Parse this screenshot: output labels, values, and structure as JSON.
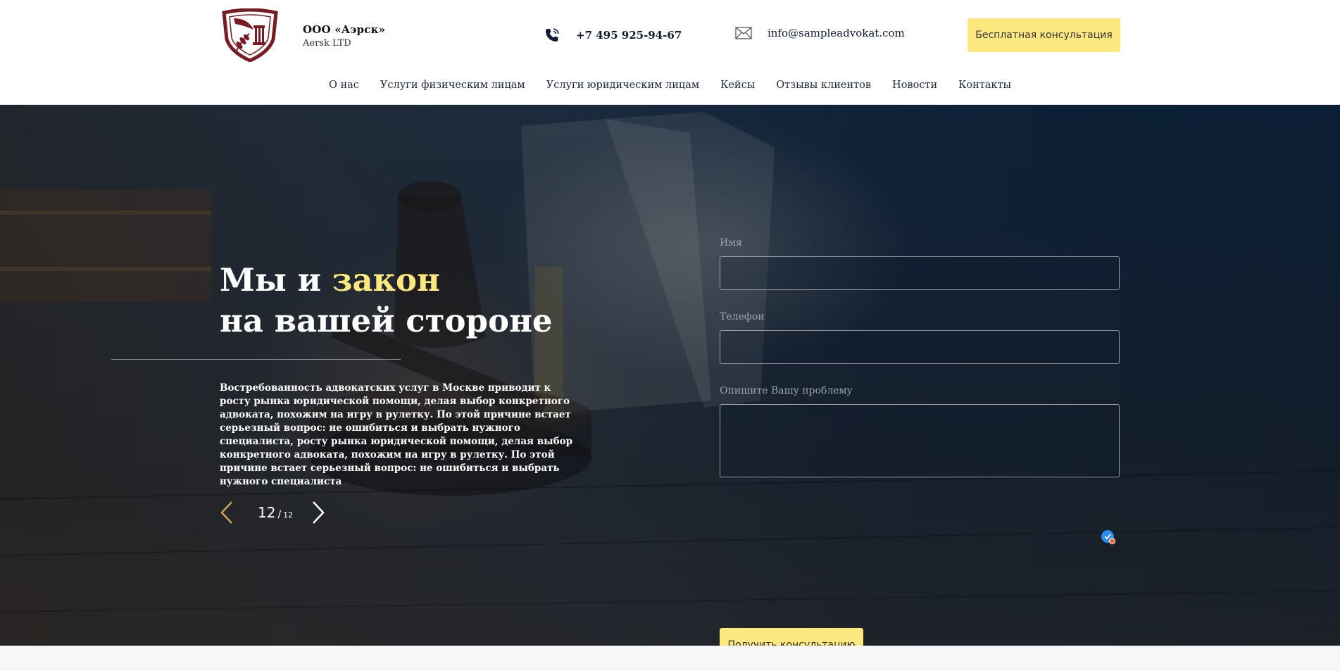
{
  "header": {
    "company_name": "ООО «Аэрск»",
    "company_sub": "Aersk LTD",
    "phone": "+7 495 925-94-67",
    "email": "info@sampleadvokat.com",
    "consult_button": "Бесплатная консультация"
  },
  "nav": {
    "items": [
      {
        "label": "О нас"
      },
      {
        "label": "Услуги физическим лицам"
      },
      {
        "label": "Услуги юридическим лицам"
      },
      {
        "label": "Кейсы"
      },
      {
        "label": "Отзывы клиентов"
      },
      {
        "label": "Новости"
      },
      {
        "label": "Контакты"
      }
    ]
  },
  "hero": {
    "title_part1": "Мы и ",
    "title_accent": "закон",
    "title_line2": "на вашей стороне",
    "description": "Востребованность адвокатских услуг в Москве приводит к росту рынка юридической помощи, делая выбор конкретного адвоката, похожим на игру в рулетку. По этой причине встает серьезный вопрос: не ошибиться и выбрать нужного специалиста, росту рынка юридической помощи, делая выбор конкретного адвоката, похожим на игру в рулетку. По этой причине встает серьезный вопрос: не ошибиться и выбрать нужного специалиста",
    "slide_current": "12",
    "slide_separator": "/",
    "slide_total": "12"
  },
  "form": {
    "name_label": "Имя",
    "name_value": "",
    "phone_label": "Телефон",
    "phone_value": "",
    "problem_label": "Опишите Вашу проблему",
    "problem_value": "",
    "submit_label": "Получить консультацию"
  },
  "colors": {
    "accent": "#fde880",
    "logo": "#7a1a22",
    "hero_bg": "#0a1e35"
  },
  "icons": {
    "phone": "phone-icon",
    "mail": "mail-icon",
    "prev": "chevron-left-icon",
    "next": "chevron-right-icon",
    "check": "check-icon"
  }
}
